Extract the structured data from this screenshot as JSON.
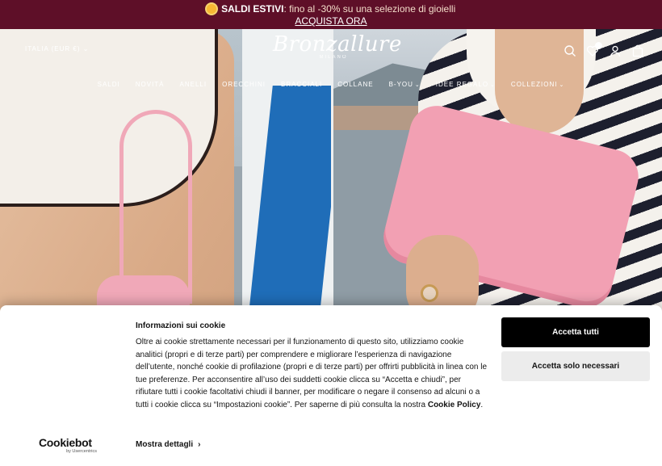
{
  "promo": {
    "icon": "sun-emoji",
    "label": "SALDI ESTIVI",
    "text": ": fino al -30% su una selezione di gioielli",
    "cta": "ACQUISTA ORA"
  },
  "header": {
    "region": "ITALIA (EUR €)",
    "logo_brand": "Bronzallure",
    "logo_sub": "MILANO",
    "icons": [
      "search-icon",
      "wishlist-heart-icon",
      "account-icon",
      "cart-bag-icon"
    ]
  },
  "nav": {
    "items": [
      {
        "label": "SALDI",
        "has_dropdown": false
      },
      {
        "label": "NOVITÀ",
        "has_dropdown": false
      },
      {
        "label": "ANELLI",
        "has_dropdown": false
      },
      {
        "label": "ORECCHINI",
        "has_dropdown": false
      },
      {
        "label": "BRACCIALI",
        "has_dropdown": false
      },
      {
        "label": "COLLANE",
        "has_dropdown": false
      },
      {
        "label": "B-YOU",
        "has_dropdown": true
      },
      {
        "label": "IDEE REGALO",
        "has_dropdown": true
      },
      {
        "label": "COLLEZIONI",
        "has_dropdown": true
      }
    ]
  },
  "cookie": {
    "provider_name": "Cookiebot",
    "provider_by": "by Usercentrics",
    "title": "Informazioni sui cookie",
    "body": "Oltre ai cookie strettamente necessari per il funzionamento di questo sito, utilizziamo cookie analitici (propri e di terze parti) per comprendere e migliorare l’esperienza di navigazione dell’utente, nonché cookie di profilazione (propri e di terze parti) per offrirti pubblicità in linea con le tue preferenze. Per acconsentire all’uso dei suddetti cookie clicca su “Accetta e chiudi”, per rifiutare tutti i cookie facoltativi chiudi il banner, per modificare o negare il consenso ad alcuni o a tutti i cookie clicca su “Impostazioni cookie”. Per saperne di più consulta la nostra",
    "policy_link": "Cookie Policy",
    "after_link": ".",
    "details_label": "Mostra dettagli",
    "accept_all": "Accetta tutti",
    "accept_necessary": "Accetta solo necessari"
  },
  "colors": {
    "promo_bg": "#5e0f28",
    "accent_blue": "#1f6db8",
    "pink_case": "#f2a0b3"
  }
}
